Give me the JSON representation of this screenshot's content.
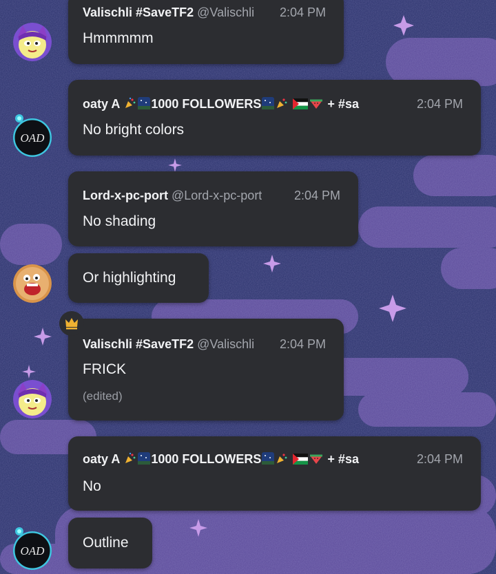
{
  "messages": [
    {
      "author": "Valischli #SaveTF2",
      "handle": "@Valischli",
      "time": "2:04 PM",
      "text": "Hmmmmm"
    },
    {
      "author_prefix": "oaty A",
      "author_main": "1000 FOLLOWERS",
      "author_suffix": "+ #sa",
      "time": "2:04 PM",
      "text": "No bright colors"
    },
    {
      "author": "Lord-x-pc-port",
      "handle": "@Lord-x-pc-port",
      "time": "2:04 PM",
      "text": "No shading"
    },
    {
      "text": "Or highlighting"
    },
    {
      "author": "Valischli #SaveTF2",
      "handle": "@Valischli",
      "time": "2:04 PM",
      "text": "FRICK",
      "edited": "(edited)"
    },
    {
      "author_prefix": "oaty A",
      "author_main": "1000 FOLLOWERS",
      "author_suffix": "+ #sa",
      "time": "2:04 PM",
      "text": "No"
    },
    {
      "text": "Outline"
    }
  ],
  "avatars": {
    "oaty_initials": "OAD"
  },
  "colors": {
    "bubble": "#2c2d31",
    "background": "#2a2f6b",
    "cloud": "#5b4a9a",
    "crown": "#f0b232"
  }
}
